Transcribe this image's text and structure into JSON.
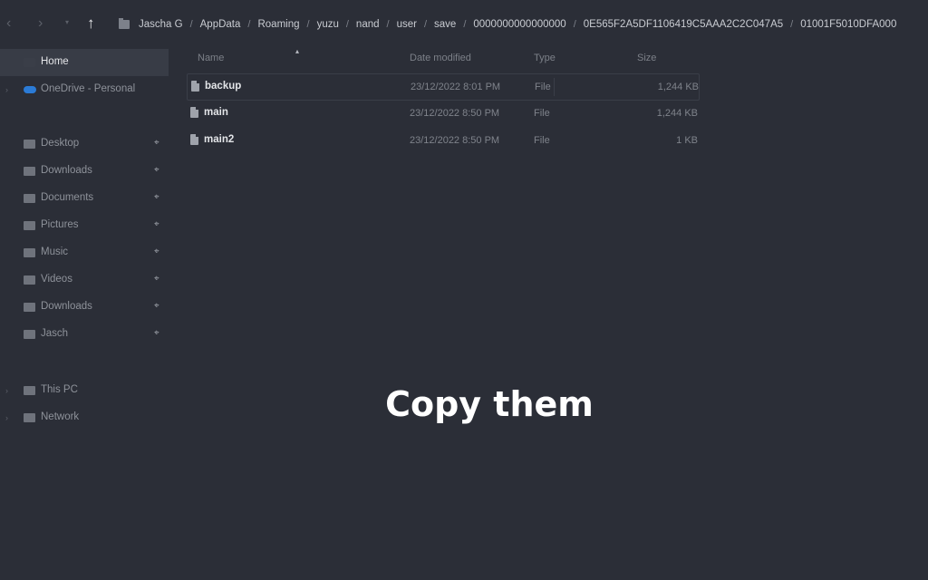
{
  "nav": {
    "back_icon": "arrow-left-icon",
    "forward_icon": "arrow-right-icon",
    "recent_icon": "chevron-down-icon",
    "up_icon": "arrow-up-icon",
    "breadcrumbs": [
      "Jascha G",
      "AppData",
      "Roaming",
      "yuzu",
      "nand",
      "user",
      "save",
      "0000000000000000",
      "0E565F2A5DF1106419C5AAA2C2C047A5",
      "01001F5010DFA000"
    ]
  },
  "sidebar": {
    "items": [
      {
        "label": "Home",
        "icon": "home-icon",
        "active": true
      },
      {
        "label": "OneDrive - Personal",
        "icon": "cloud-icon"
      },
      {
        "label": "Desktop",
        "icon": "desktop-icon",
        "pinned": true
      },
      {
        "label": "Downloads",
        "icon": "download-icon",
        "pinned": true
      },
      {
        "label": "Documents",
        "icon": "documents-icon",
        "pinned": true
      },
      {
        "label": "Pictures",
        "icon": "pictures-icon",
        "pinned": true
      },
      {
        "label": "Music",
        "icon": "music-icon",
        "pinned": true
      },
      {
        "label": "Videos",
        "icon": "videos-icon",
        "pinned": true
      },
      {
        "label": "Downloads",
        "icon": "folder-icon",
        "pinned": true
      },
      {
        "label": "Jasch",
        "icon": "folder-icon",
        "pinned": true
      },
      {
        "label": "This PC",
        "icon": "pc-icon"
      },
      {
        "label": "Network",
        "icon": "network-icon"
      }
    ]
  },
  "columns": {
    "name": "Name",
    "date": "Date modified",
    "type": "Type",
    "size": "Size"
  },
  "files": [
    {
      "name": "backup",
      "date": "23/12/2022 8:01 PM",
      "type": "File",
      "size": "1,244 KB"
    },
    {
      "name": "main",
      "date": "23/12/2022 8:50 PM",
      "type": "File",
      "size": "1,244 KB"
    },
    {
      "name": "main2",
      "date": "23/12/2022 8:50 PM",
      "type": "File",
      "size": "1 KB"
    }
  ],
  "overlay_text": "Copy them"
}
